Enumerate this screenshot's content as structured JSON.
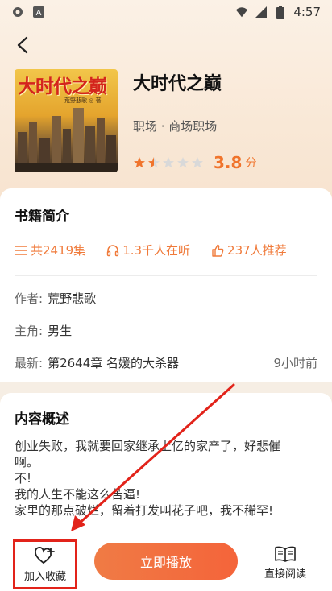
{
  "status_bar": {
    "time": "4:57",
    "icons": [
      "settings-gear-icon",
      "a-app-icon",
      "wifi-icon",
      "signal-icon",
      "battery-icon"
    ]
  },
  "book": {
    "cover_title": "大时代之巅",
    "cover_author": "荒野悲歌 ◎ 著",
    "title": "大时代之巅",
    "category": "职场 · 商场职场",
    "rating": 1.5,
    "rating_max": 5,
    "score": "3.8",
    "score_unit": "分"
  },
  "info": {
    "section_title": "书籍简介",
    "episodes": "共2419集",
    "listeners": "1.3千人在听",
    "recommends": "237人推荐",
    "author_label": "作者:",
    "author": "荒野悲歌",
    "protagonist_label": "主角:",
    "protagonist": "男生",
    "latest_label": "最新:",
    "latest": "第2644章 名媛的大杀器",
    "latest_time": "9小时前"
  },
  "description": {
    "section_title": "内容概述",
    "lines": [
      "创业失败，我就要回家继承上亿的家产了，好悲催",
      "啊。",
      "不!",
      "我的人生不能这么苦逼!",
      "家里的那点破烂，留着打发叫花子吧，我不稀罕!"
    ]
  },
  "bottom_bar": {
    "favorite_label": "加入收藏",
    "play_label": "立即播放",
    "read_label": "直接阅读"
  },
  "colors": {
    "accent": "#f0742c",
    "highlight_box": "#e2231a",
    "arrow": "#e2231a"
  }
}
